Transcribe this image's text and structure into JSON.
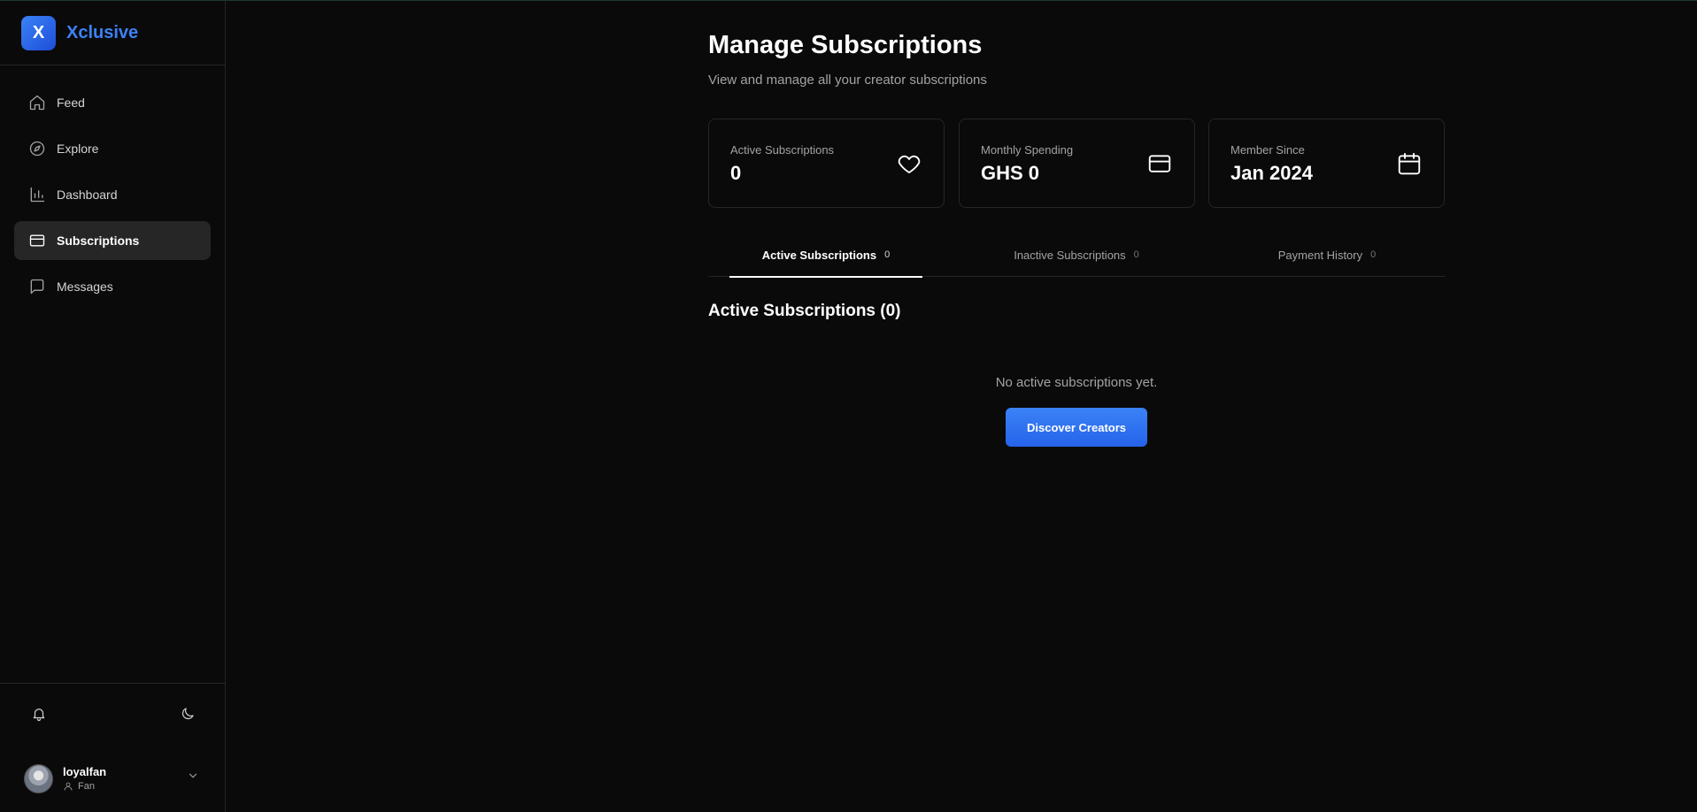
{
  "brand": {
    "logo_letter": "X",
    "name": "Xclusive",
    "accent": "#3b82f6"
  },
  "sidebar": {
    "items": [
      {
        "label": "Feed",
        "icon": "home-icon",
        "active": false
      },
      {
        "label": "Explore",
        "icon": "compass-icon",
        "active": false
      },
      {
        "label": "Dashboard",
        "icon": "bar-chart-icon",
        "active": false
      },
      {
        "label": "Subscriptions",
        "icon": "credit-card-icon",
        "active": true
      },
      {
        "label": "Messages",
        "icon": "message-square-icon",
        "active": false
      }
    ],
    "footer": {
      "icons": [
        "bell-icon",
        "moon-icon"
      ],
      "user": {
        "name": "loyalfan",
        "role": "Fan"
      }
    }
  },
  "main": {
    "title": "Manage Subscriptions",
    "subtitle": "View and manage all your creator subscriptions",
    "stats": [
      {
        "label": "Active Subscriptions",
        "value": "0",
        "icon": "heart-icon"
      },
      {
        "label": "Monthly Spending",
        "value": "GHS 0",
        "icon": "credit-card-icon"
      },
      {
        "label": "Member Since",
        "value": "Jan 2024",
        "icon": "calendar-icon"
      }
    ],
    "tabs": [
      {
        "label": "Active Subscriptions",
        "count": "0",
        "active": true
      },
      {
        "label": "Inactive Subscriptions",
        "count": "0",
        "active": false
      },
      {
        "label": "Payment History",
        "count": "0",
        "active": false
      }
    ],
    "section_title": "Active Subscriptions (0)",
    "empty_message": "No active subscriptions yet.",
    "cta_label": "Discover Creators"
  }
}
